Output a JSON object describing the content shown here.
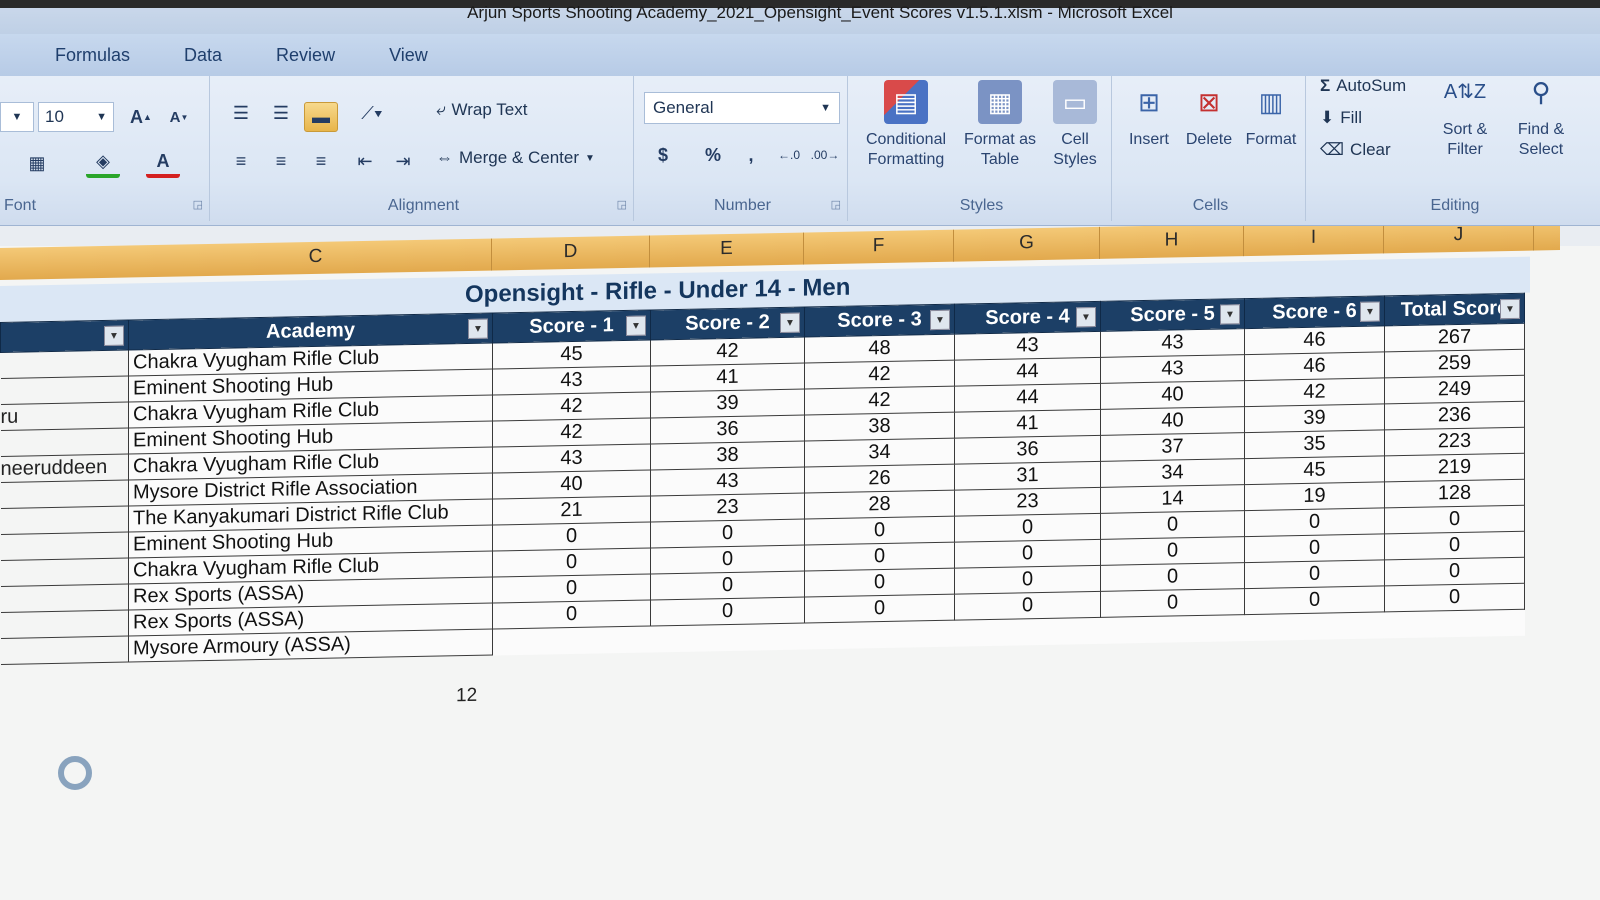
{
  "window": {
    "title": "Arjun Sports Shooting Academy_2021_Opensight_Event Scores v1.5.1.xlsm - Microsoft Excel"
  },
  "tabs": [
    "Formulas",
    "Data",
    "Review",
    "View"
  ],
  "font": {
    "size": "10",
    "group_label": "Font"
  },
  "alignment": {
    "wrap_text": "Wrap Text",
    "merge_center": "Merge & Center",
    "group_label": "Alignment"
  },
  "number": {
    "format": "General",
    "currency": "$",
    "percent": "%",
    "comma": ",",
    "group_label": "Number"
  },
  "styles": {
    "conditional": "Conditional Formatting",
    "format_table": "Format as Table",
    "cell_styles": "Cell Styles",
    "group_label": "Styles"
  },
  "cells": {
    "insert": "Insert",
    "delete": "Delete",
    "format": "Format",
    "group_label": "Cells"
  },
  "editing": {
    "autosum": "AutoSum",
    "fill": "Fill",
    "clear": "Clear",
    "sort_filter": "Sort & Filter",
    "find_select": "Find & Select",
    "group_label": "Editing"
  },
  "columns": [
    "C",
    "D",
    "E",
    "F",
    "G",
    "H",
    "I",
    "J"
  ],
  "table": {
    "title": "Opensight - Rifle - Under 14 - Men",
    "headers": [
      "Academy",
      "Score - 1",
      "Score - 2",
      "Score - 3",
      "Score - 4",
      "Score - 5",
      "Score - 6",
      "Total Score"
    ],
    "rows": [
      {
        "side": "",
        "academy": "Chakra Vyugham Rifle Club",
        "scores": [
          "45",
          "42",
          "48",
          "43",
          "43",
          "46",
          "267"
        ]
      },
      {
        "side": "",
        "academy": "Eminent Shooting Hub",
        "scores": [
          "43",
          "41",
          "42",
          "44",
          "43",
          "46",
          "259"
        ]
      },
      {
        "side": "ru",
        "academy": "Chakra Vyugham Rifle Club",
        "scores": [
          "42",
          "39",
          "42",
          "44",
          "40",
          "42",
          "249"
        ]
      },
      {
        "side": "",
        "academy": "Eminent Shooting Hub",
        "scores": [
          "42",
          "36",
          "38",
          "41",
          "40",
          "39",
          "236"
        ]
      },
      {
        "side": "neeruddeen",
        "academy": "Chakra Vyugham Rifle Club",
        "scores": [
          "43",
          "38",
          "34",
          "36",
          "37",
          "35",
          "223"
        ]
      },
      {
        "side": "",
        "academy": "Mysore District Rifle Association",
        "scores": [
          "40",
          "43",
          "26",
          "31",
          "34",
          "45",
          "219"
        ]
      },
      {
        "side": "",
        "academy": "The Kanyakumari District Rifle Club",
        "scores": [
          "21",
          "23",
          "28",
          "23",
          "14",
          "19",
          "128"
        ]
      },
      {
        "side": "",
        "academy": "Eminent Shooting Hub",
        "scores": [
          "0",
          "0",
          "0",
          "0",
          "0",
          "0",
          "0"
        ]
      },
      {
        "side": "",
        "academy": "Chakra Vyugham Rifle Club",
        "scores": [
          "0",
          "0",
          "0",
          "0",
          "0",
          "0",
          "0"
        ]
      },
      {
        "side": "",
        "academy": "Rex Sports (ASSA)",
        "scores": [
          "0",
          "0",
          "0",
          "0",
          "0",
          "0",
          "0"
        ]
      },
      {
        "side": "",
        "academy": "Rex Sports (ASSA)",
        "scores": [
          "0",
          "0",
          "0",
          "0",
          "0",
          "0",
          "0"
        ]
      },
      {
        "side": "",
        "academy": "Mysore Armoury (ASSA)",
        "scores": [
          "",
          "",
          "",
          "",
          "",
          "",
          ""
        ]
      }
    ],
    "count": "12"
  },
  "colors": {
    "header_bg": "#1c3f66",
    "col_header": "#f0c070",
    "accent": "#2b579a"
  }
}
